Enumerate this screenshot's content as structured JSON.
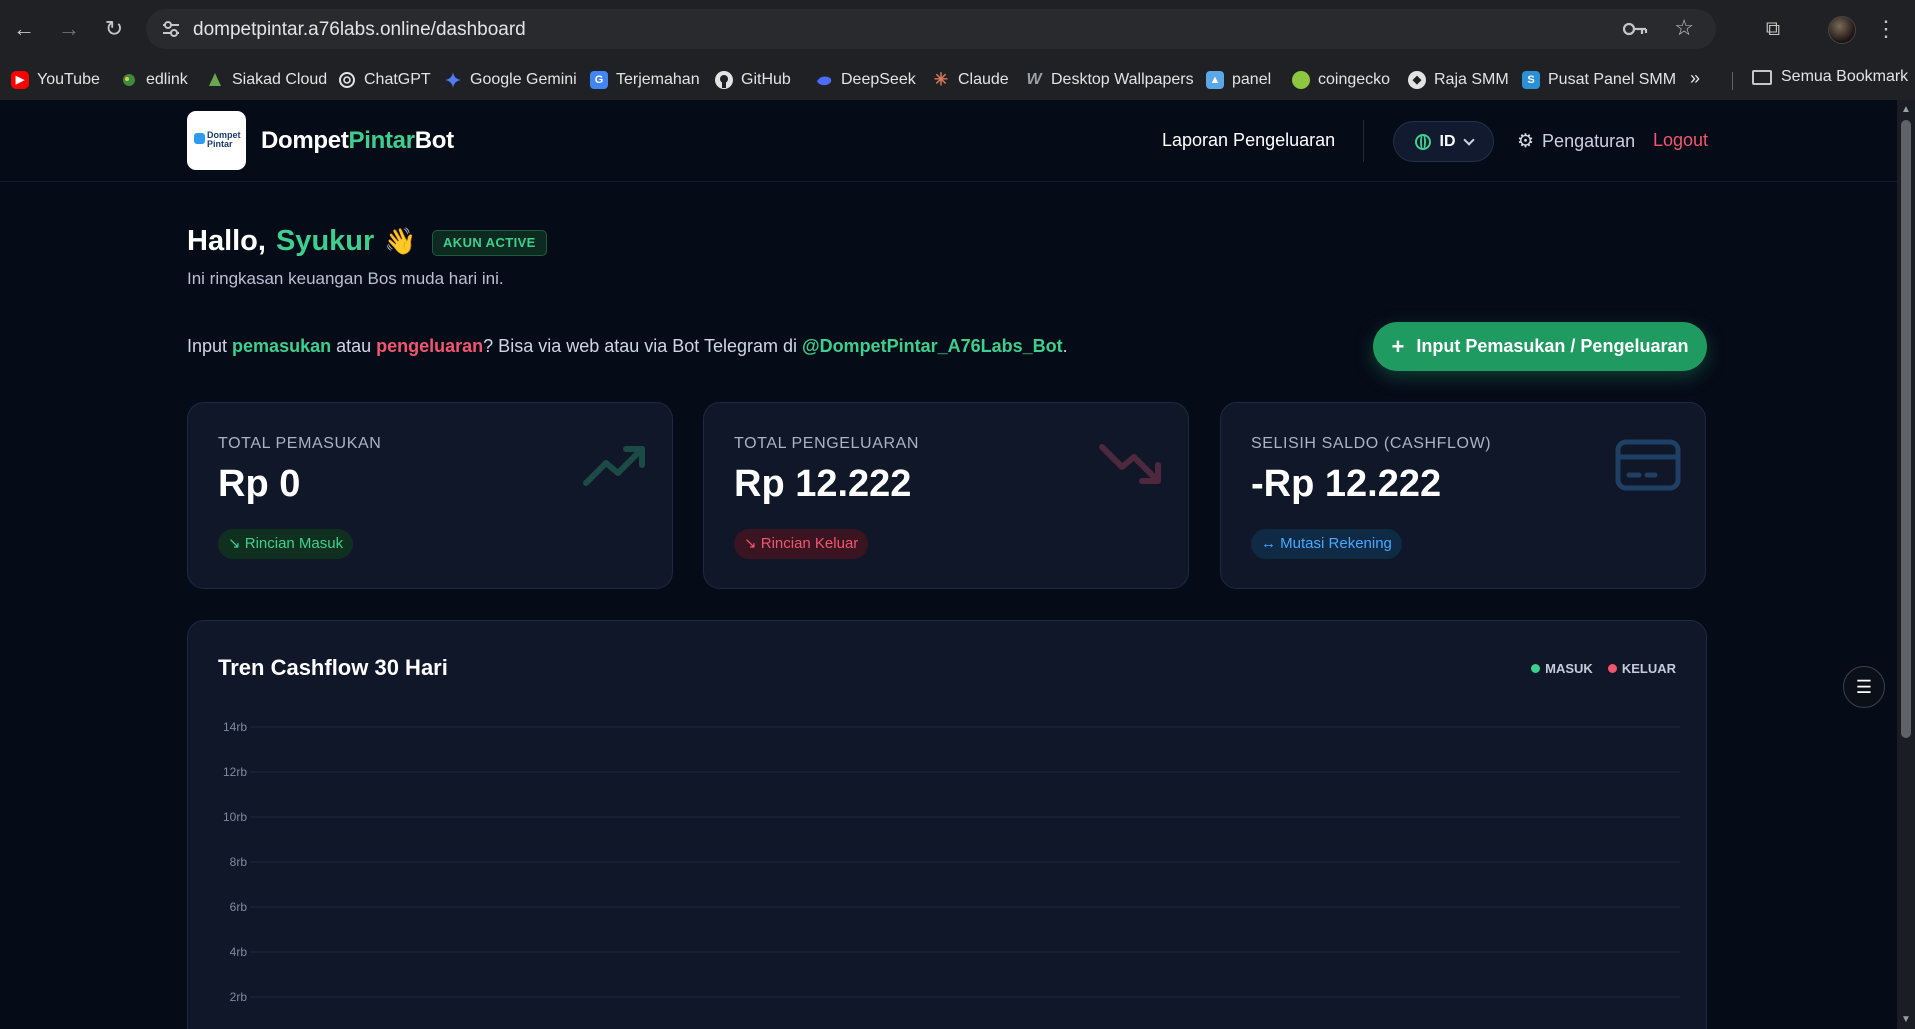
{
  "browser": {
    "url": "dompetpintar.a76labs.online/dashboard",
    "bookmarks": [
      {
        "label": "YouTube",
        "color": "#ff0000"
      },
      {
        "label": "edlink",
        "color": "#3b8c3b"
      },
      {
        "label": "Siakad Cloud",
        "color": "#6aa84f"
      },
      {
        "label": "ChatGPT",
        "color": "#5f6368"
      },
      {
        "label": "Google Gemini",
        "color": "#4f7df3"
      },
      {
        "label": "Terjemahan",
        "color": "#4285f4"
      },
      {
        "label": "GitHub",
        "color": "#5f6368"
      },
      {
        "label": "DeepSeek",
        "color": "#4d6bfe"
      },
      {
        "label": "Claude",
        "color": "#d97757"
      },
      {
        "label": "Desktop Wallpapers",
        "color": "#9aa0a6"
      },
      {
        "label": "panel",
        "color": "#5aa9e6"
      },
      {
        "label": "coingecko",
        "color": "#8dc63f"
      },
      {
        "label": "Raja SMM",
        "color": "#e3e3e3"
      },
      {
        "label": "Pusat Panel SMM",
        "color": "#2d8fd5"
      }
    ],
    "more": "»",
    "folder": "Semua Bookmark"
  },
  "header": {
    "logo_line1": "Dompet",
    "logo_line2": "Pintar",
    "brand_part1": "Dompet",
    "brand_part2": "Pintar",
    "brand_part3": "Bot",
    "nav_report": "Laporan Pengeluaran",
    "lang": "ID",
    "settings": "Pengaturan",
    "logout": "Logout"
  },
  "greeting": {
    "hello": "Hallo,",
    "name": "Syukur",
    "wave": "👋",
    "badge": "AKUN ACTIVE",
    "subtitle": "Ini ringkasan keuangan Bos muda hari ini."
  },
  "input_hint": {
    "t1": "Input ",
    "income": "pemasukan",
    "t2": " atau ",
    "expense": "pengeluaran",
    "t3": "? Bisa via web atau via Bot Telegram di ",
    "bot": "@DompetPintar_A76Labs_Bot",
    "t4": "."
  },
  "input_button": {
    "plus": "+",
    "label": "Input Pemasukan / Pengeluaran"
  },
  "cards": [
    {
      "label": "TOTAL PEMASUKAN",
      "value": "Rp 0",
      "pill": "↘ Rincian Masuk",
      "accent": "#3ecf8e"
    },
    {
      "label": "TOTAL PENGELUARAN",
      "value": "Rp 12.222",
      "pill": "↘ Rincian Keluar",
      "accent": "#f2566f"
    },
    {
      "label": "SELISIH SALDO (CASHFLOW)",
      "value": "-Rp 12.222",
      "pill": "↔ Mutasi Rekening",
      "accent": "#4aa8ff"
    }
  ],
  "chart_data": {
    "type": "line",
    "title": "Tren Cashflow 30 Hari",
    "ytick_labels": [
      "14rb",
      "12rb",
      "10rb",
      "8rb",
      "6rb",
      "4rb",
      "2rb"
    ],
    "yticks": [
      14000,
      12000,
      10000,
      8000,
      6000,
      4000,
      2000
    ],
    "ylim": [
      0,
      14000
    ],
    "grid": true,
    "legend_position": "top-right",
    "series": [
      {
        "name": "MASUK",
        "color": "#3ecf8e",
        "values": []
      },
      {
        "name": "KELUAR",
        "color": "#f2566f",
        "values": []
      }
    ]
  },
  "colors": {
    "accent_green": "#3ecf8e",
    "accent_red": "#f2566f",
    "accent_blue": "#4aa8ff",
    "background": "#060b18",
    "card": "#0f1729"
  },
  "icons": {
    "floating_button": "filter-list-icon"
  }
}
